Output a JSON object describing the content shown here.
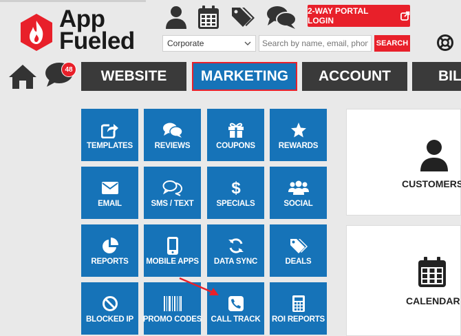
{
  "brand": {
    "line1": "App",
    "line2": "Fueled",
    "tm": "™"
  },
  "header": {
    "icons": [
      "user-icon",
      "calendar-icon",
      "tags-icon",
      "comments-icon"
    ],
    "portal_login": "2-WAY PORTAL LOGIN",
    "location_select": "Corporate",
    "search_placeholder": "Search by name, email, phone",
    "search_button": "SEARCH",
    "notification_count": "48"
  },
  "nav": {
    "tabs": [
      {
        "label": "WEBSITE",
        "active": false
      },
      {
        "label": "MARKETING",
        "active": true
      },
      {
        "label": "ACCOUNT",
        "active": false
      },
      {
        "label": "BILL",
        "active": false
      }
    ]
  },
  "tiles": [
    {
      "label": "TEMPLATES",
      "icon": "share-square-icon"
    },
    {
      "label": "REVIEWS",
      "icon": "comments-icon"
    },
    {
      "label": "COUPONS",
      "icon": "gift-icon"
    },
    {
      "label": "REWARDS",
      "icon": "star-icon"
    },
    {
      "label": "EMAIL",
      "icon": "envelope-icon"
    },
    {
      "label": "SMS / TEXT",
      "icon": "chat-outline-icon"
    },
    {
      "label": "SPECIALS",
      "icon": "dollar-icon"
    },
    {
      "label": "SOCIAL",
      "icon": "users-icon"
    },
    {
      "label": "REPORTS",
      "icon": "pie-chart-icon"
    },
    {
      "label": "MOBILE APPS",
      "icon": "mobile-icon"
    },
    {
      "label": "DATA SYNC",
      "icon": "sync-icon"
    },
    {
      "label": "DEALS",
      "icon": "tags-icon"
    },
    {
      "label": "BLOCKED IP",
      "icon": "ban-icon"
    },
    {
      "label": "PROMO CODES",
      "icon": "barcode-icon"
    },
    {
      "label": "CALL TRACK",
      "icon": "phone-icon"
    },
    {
      "label": "ROI REPORTS",
      "icon": "calculator-icon"
    }
  ],
  "cards": [
    {
      "label": "CUSTOMERS",
      "icon": "user-icon"
    },
    {
      "label": "CALENDAR",
      "icon": "calendar-icon"
    }
  ],
  "colors": {
    "accent_red": "#e8202a",
    "tile_blue": "#1673b8",
    "nav_dark": "#3a3a3a"
  }
}
